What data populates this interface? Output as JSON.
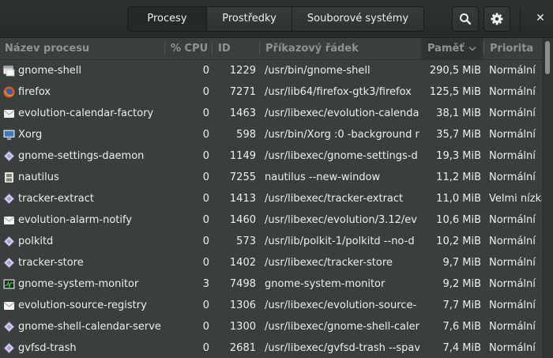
{
  "tabs": [
    {
      "label": "Procesy",
      "active": true
    },
    {
      "label": "Prostředky",
      "active": false
    },
    {
      "label": "Souborové systémy",
      "active": false
    }
  ],
  "header_icons": {
    "search": "search-icon",
    "menu": "gear-icon",
    "close": "close-icon",
    "close_glyph": "✕"
  },
  "columns": {
    "name": "Název procesu",
    "cpu": "% CPU",
    "id": "ID",
    "cmd": "Příkazový řádek",
    "mem": "Paměť",
    "mem_sort": "descending",
    "priority": "Priorita"
  },
  "processes": [
    {
      "icon": "window-icon",
      "name": "gnome-shell",
      "cpu": "0",
      "id": "1229",
      "cmd": "/usr/bin/gnome-shell",
      "mem": "290,5 MiB",
      "priority": "Normální"
    },
    {
      "icon": "firefox-icon",
      "name": "firefox",
      "cpu": "0",
      "id": "7271",
      "cmd": "/usr/lib64/firefox-gtk3/firefox",
      "mem": "125,5 MiB",
      "priority": "Normální"
    },
    {
      "icon": "envelope-icon",
      "name": "evolution-calendar-factory",
      "cpu": "0",
      "id": "1463",
      "cmd": "/usr/libexec/evolution-calendar",
      "mem": "38,1 MiB",
      "priority": "Normální"
    },
    {
      "icon": "monitor-icon",
      "name": "Xorg",
      "cpu": "0",
      "id": "598",
      "cmd": "/usr/bin/Xorg :0 -background n",
      "mem": "35,7 MiB",
      "priority": "Normální"
    },
    {
      "icon": "diamond-icon",
      "name": "gnome-settings-daemon",
      "cpu": "0",
      "id": "1149",
      "cmd": "/usr/libexec/gnome-settings-d",
      "mem": "19,3 MiB",
      "priority": "Normální"
    },
    {
      "icon": "file-cabinet-icon",
      "name": "nautilus",
      "cpu": "0",
      "id": "7255",
      "cmd": "nautilus --new-window",
      "mem": "11,2 MiB",
      "priority": "Normální"
    },
    {
      "icon": "diamond-icon",
      "name": "tracker-extract",
      "cpu": "0",
      "id": "1413",
      "cmd": "/usr/libexec/tracker-extract",
      "mem": "11,0 MiB",
      "priority": "Velmi nízká"
    },
    {
      "icon": "envelope-icon",
      "name": "evolution-alarm-notify",
      "cpu": "0",
      "id": "1460",
      "cmd": "/usr/libexec/evolution/3.12/ev",
      "mem": "10,6 MiB",
      "priority": "Normální"
    },
    {
      "icon": "diamond-icon",
      "name": "polkitd",
      "cpu": "0",
      "id": "573",
      "cmd": "/usr/lib/polkit-1/polkitd --no-d",
      "mem": "10,2 MiB",
      "priority": "Normální"
    },
    {
      "icon": "diamond-icon",
      "name": "tracker-store",
      "cpu": "0",
      "id": "1402",
      "cmd": "/usr/libexec/tracker-store",
      "mem": "9,7 MiB",
      "priority": "Normální"
    },
    {
      "icon": "system-monitor-icon",
      "name": "gnome-system-monitor",
      "cpu": "3",
      "id": "7498",
      "cmd": "gnome-system-monitor",
      "mem": "9,2 MiB",
      "priority": "Normální"
    },
    {
      "icon": "envelope-icon",
      "name": "evolution-source-registry",
      "cpu": "0",
      "id": "1306",
      "cmd": "/usr/libexec/evolution-source-",
      "mem": "7,7 MiB",
      "priority": "Normální"
    },
    {
      "icon": "diamond-icon",
      "name": "gnome-shell-calendar-serve",
      "cpu": "0",
      "id": "1300",
      "cmd": "/usr/libexec/gnome-shell-caler",
      "mem": "7,6 MiB",
      "priority": "Normální"
    },
    {
      "icon": "diamond-icon",
      "name": "gvfsd-trash",
      "cpu": "0",
      "id": "2681",
      "cmd": "/usr/libexec/gvfsd-trash --spav",
      "mem": "7,4 MiB",
      "priority": "Normální"
    }
  ]
}
